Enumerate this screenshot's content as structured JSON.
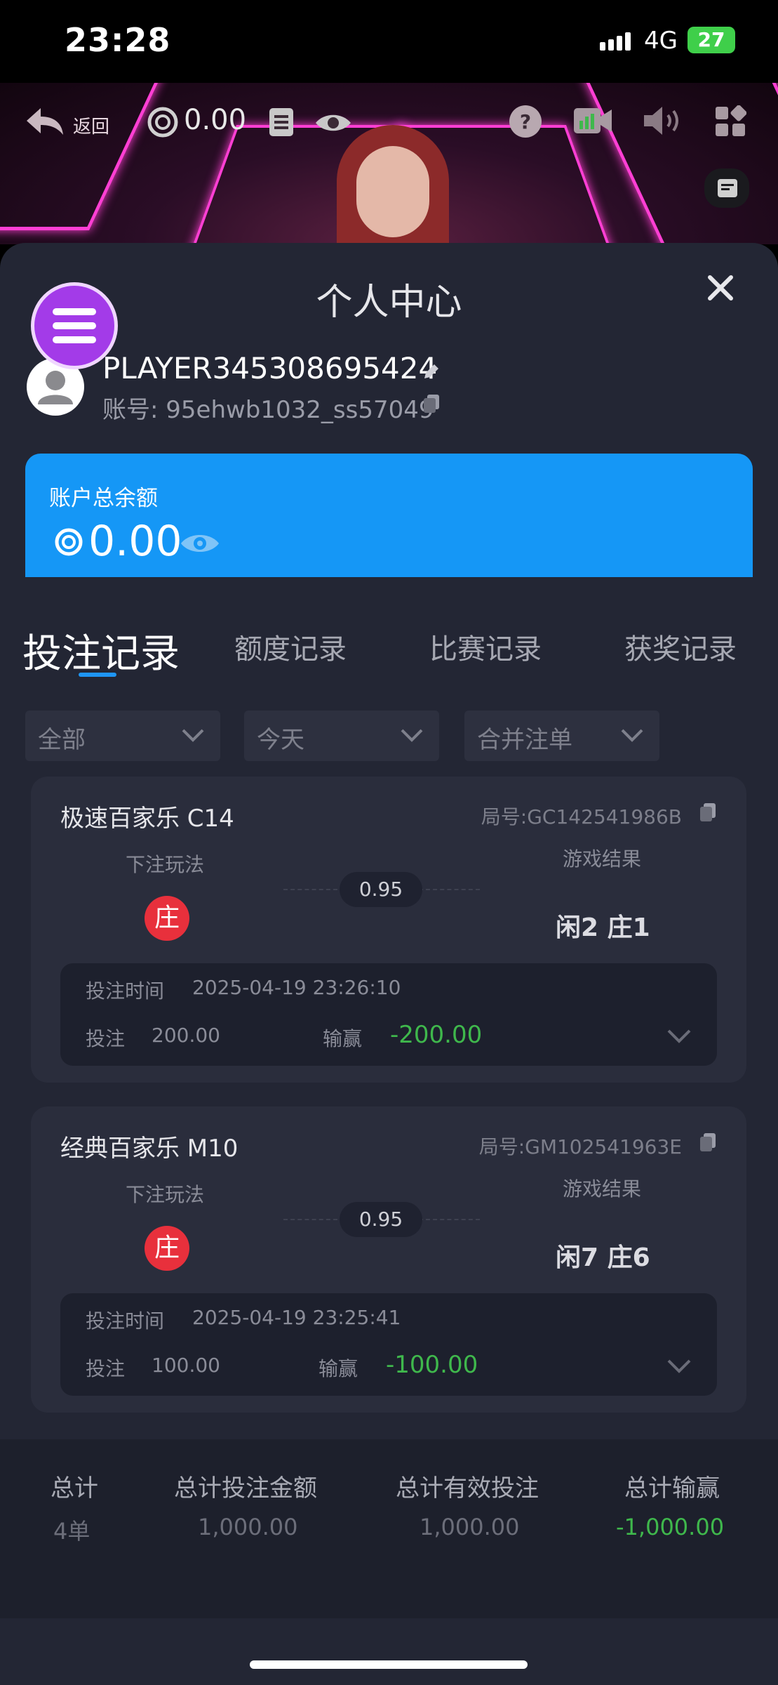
{
  "status_bar": {
    "time": "23:28",
    "network": "4G",
    "battery": "27"
  },
  "video_bar": {
    "back_label": "返回",
    "chip_balance": "0.00"
  },
  "sheet": {
    "title": "个人中心",
    "player_name": "PLAYER345308695424",
    "account": "账号: 95ehwb1032_ss57049",
    "balance_label": "账户总余额",
    "balance_value": "0.00"
  },
  "tabs": [
    {
      "label": "投注记录",
      "active": true
    },
    {
      "label": "额度记录",
      "active": false
    },
    {
      "label": "比赛记录",
      "active": false
    },
    {
      "label": "获奖记录",
      "active": false
    }
  ],
  "filters": [
    {
      "value": "全部"
    },
    {
      "value": "今天"
    },
    {
      "value": "合并注单"
    }
  ],
  "records": [
    {
      "game": "极速百家乐 C14",
      "round_no": "局号:GC142541986B",
      "mode_label": "下注玩法",
      "result_label": "游戏结果",
      "bet_side": "庄",
      "odds": "0.95",
      "result": "闲2  庄1",
      "time_label": "投注时间",
      "time": "2025-04-19 23:26:10",
      "stake_label": "投注",
      "stake": "200.00",
      "winloss_label": "输赢",
      "winloss": "-200.00"
    },
    {
      "game": "经典百家乐 M10",
      "round_no": "局号:GM102541963E",
      "mode_label": "下注玩法",
      "result_label": "游戏结果",
      "bet_side": "庄",
      "odds": "0.95",
      "result": "闲7  庄6",
      "time_label": "投注时间",
      "time": "2025-04-19 23:25:41",
      "stake_label": "投注",
      "stake": "100.00",
      "winloss_label": "输赢",
      "winloss": "-100.00"
    }
  ],
  "footer": {
    "headers": [
      "总计",
      "总计投注金额",
      "总计有效投注",
      "总计输赢"
    ],
    "values": [
      "4单",
      "1,000.00",
      "1,000.00",
      "-1,000.00"
    ]
  },
  "colors": {
    "accent": "#1597f6",
    "win_loss": "#3fb84c",
    "banker": "#e8303c",
    "menu": "#a33be8"
  }
}
